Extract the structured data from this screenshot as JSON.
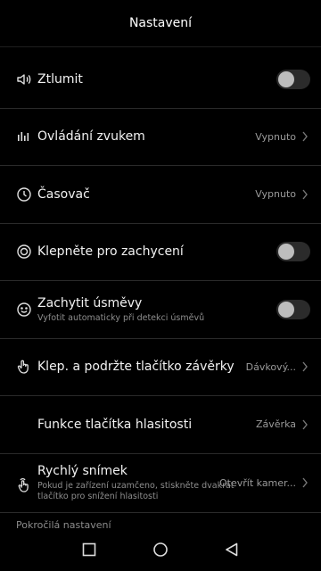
{
  "header": {
    "title": "Nastavení"
  },
  "rows": [
    {
      "title": "Ztlumit",
      "icon": "speaker-icon",
      "control": "toggle",
      "checked": false
    },
    {
      "title": "Ovládání zvukem",
      "icon": "sound-bars-icon",
      "control": "value",
      "value": "Vypnuto"
    },
    {
      "title": "Časovač",
      "icon": "clock-icon",
      "control": "value",
      "value": "Vypnuto"
    },
    {
      "title": "Klepněte pro zachycení",
      "icon": "target-circle-icon",
      "control": "toggle",
      "checked": false
    },
    {
      "title": "Zachytit úsměvy",
      "subtitle": "Vyfotit automaticky při detekci úsměvů",
      "icon": "smile-icon",
      "control": "toggle",
      "checked": false
    },
    {
      "title": "Klep. a podržte tlačítko závěrky",
      "icon": "hand-press-icon",
      "control": "value",
      "value": "Dávkový..."
    },
    {
      "title": "Funkce tlačítka hlasitosti",
      "icon": "none",
      "control": "value",
      "value": "Závěrka"
    },
    {
      "title": "Rychlý snímek",
      "subtitle": "Pokud je zařízení uzamčeno, stiskněte dvakrát tlačítko pro snížení hlasitosti",
      "icon": "double-tap-icon",
      "control": "value",
      "value": "Otevřít kamer..."
    }
  ],
  "section_label": "Pokročilá nastavení",
  "navbar": {
    "buttons": [
      "recents-square-icon",
      "home-circle-icon",
      "back-triangle-icon"
    ]
  },
  "colors": {
    "background": "#000000",
    "text": "#f2f2f2",
    "secondary": "#8e8e8e",
    "divider": "#2a2a2a"
  }
}
